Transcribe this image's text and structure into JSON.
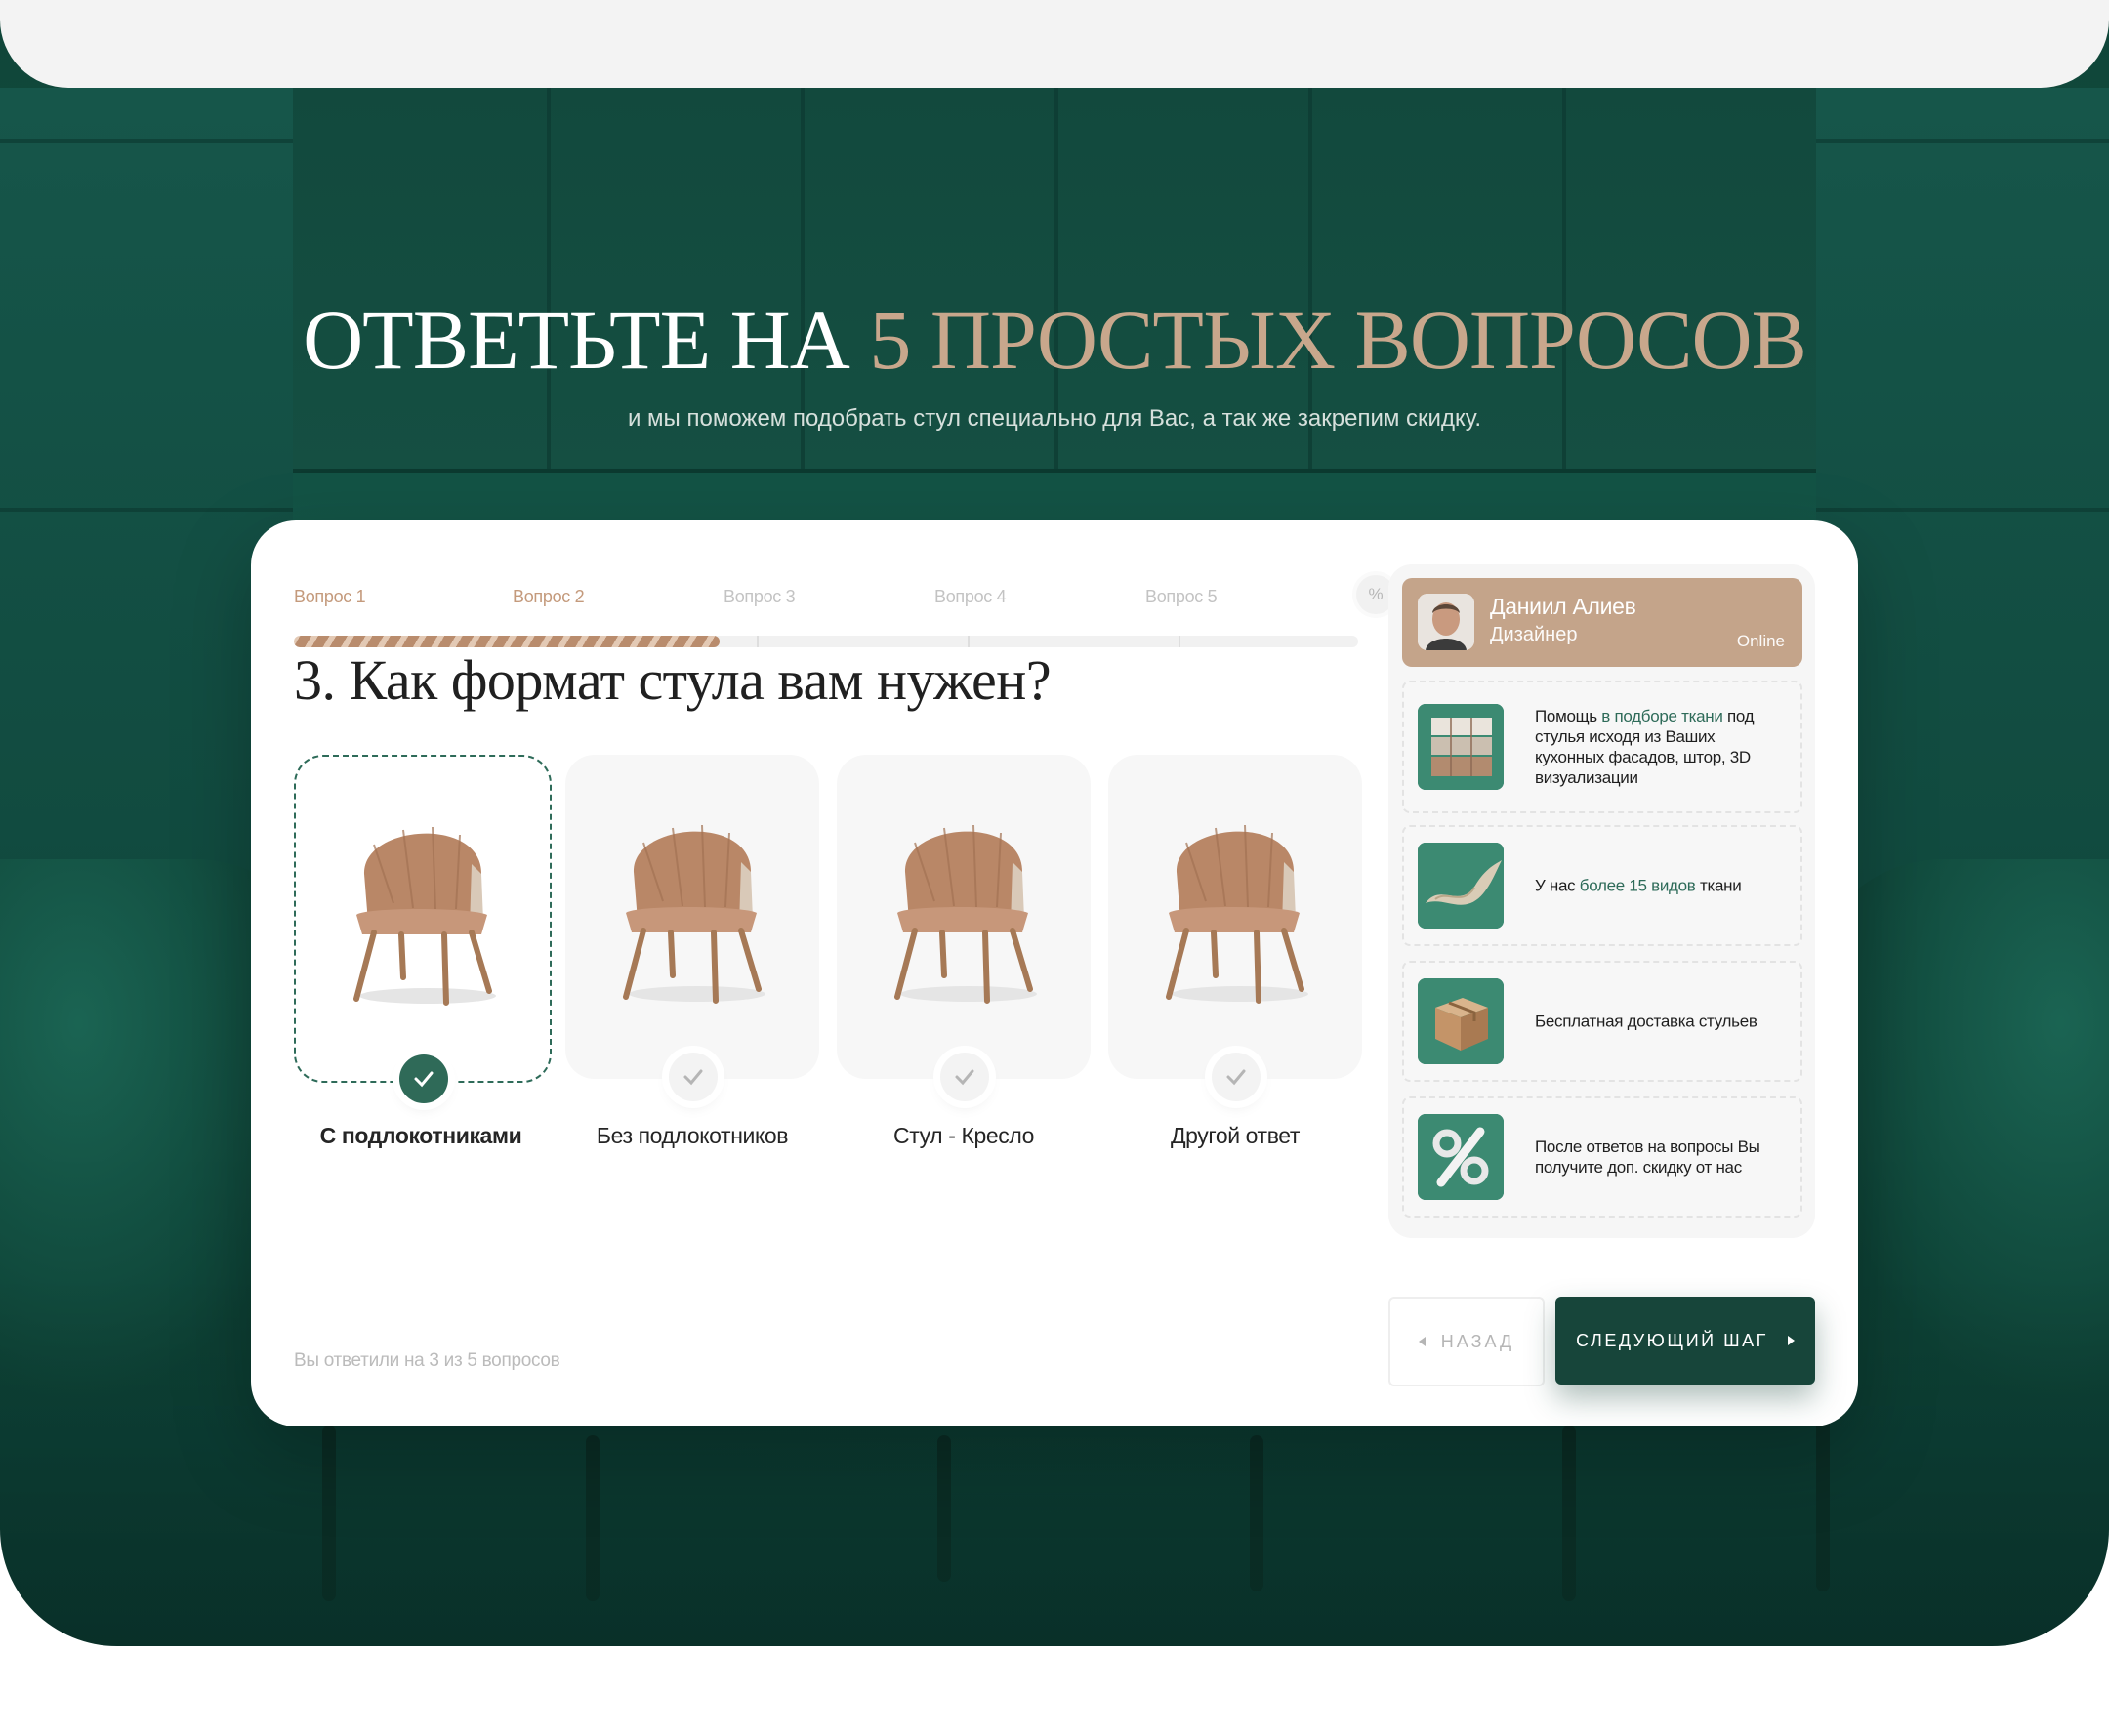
{
  "header": {
    "title_plain": "ОТВЕТЬТЕ НА ",
    "title_accent": "5 ПРОСТЫХ ВОПРОСОВ",
    "subtitle": "и мы поможем подобрать стул специально для Вас, а так же закрепим скидку."
  },
  "stepper": {
    "steps": [
      "Вопрос 1",
      "Вопрос 2",
      "Вопрос 3",
      "Вопрос 4",
      "Вопрос 5"
    ],
    "discount_symbol": "%",
    "completed_fraction": 0.4
  },
  "question": "3. Как формат стула вам нужен?",
  "options": [
    {
      "label": "С подлокотниками",
      "selected": true
    },
    {
      "label": "Без подлокотников",
      "selected": false
    },
    {
      "label": "Стул - Кресло",
      "selected": false
    },
    {
      "label": "Другой ответ",
      "selected": false
    }
  ],
  "footer": {
    "answered": "Вы ответили на 3 из 5 вопросов"
  },
  "consultant": {
    "name": "Даниил Алиев",
    "role": "Дизайнер",
    "status": "Online"
  },
  "features": [
    {
      "icon": "kitchen-facade-icon",
      "pre": "Помощь ",
      "hl": "в подборе ткани",
      "post": " под стулья исходя из Ваших кухонных фасадов, штор, 3D визуализации"
    },
    {
      "icon": "fabric-icon",
      "pre": "У нас ",
      "hl": "более 15 видов",
      "post": " ткани"
    },
    {
      "icon": "box-icon",
      "pre": "Бесплатная доставка стульев",
      "hl": "",
      "post": ""
    },
    {
      "icon": "percent-icon",
      "pre": "После ответов на вопросы Вы получите доп. скидку от нас",
      "hl": "",
      "post": ""
    }
  ],
  "buttons": {
    "back": "НАЗАД",
    "next": "СЛЕДУЮЩИЙ ШАГ"
  },
  "colors": {
    "brand_green": "#17453a",
    "accent_tan": "#c4a48a",
    "check_green": "#2f6a58"
  }
}
